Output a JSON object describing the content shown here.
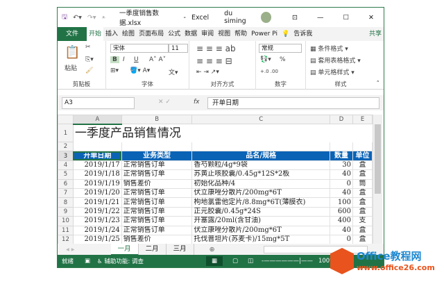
{
  "title": {
    "filename": "一季度销售数据.xlsx",
    "sep": "-",
    "app": "Excel",
    "user": "du siming"
  },
  "tabs": [
    "文件",
    "开始",
    "插入",
    "绘图",
    "页面布局",
    "公式",
    "数据",
    "审阅",
    "视图",
    "帮助",
    "Power Pi",
    "告诉我",
    "共享"
  ],
  "ribbon": {
    "paste": "粘贴",
    "clipboard": "剪贴板",
    "font_name": "宋体",
    "font_size": "11",
    "font": "字体",
    "align": "对齐方式",
    "number_format": "常规",
    "number": "数字",
    "cond_format": "条件格式",
    "table_format": "套用表格格式",
    "cell_style": "单元格样式",
    "styles": "样式",
    "percent": "%",
    "bold": "B",
    "italic": "I",
    "underline": "U"
  },
  "formula_bar": {
    "name_box": "A3",
    "fx": "fx",
    "value": "开单日期"
  },
  "columns": [
    "A",
    "B",
    "C",
    "D",
    "E"
  ],
  "title_row": "一季度产品销售情况",
  "headers": [
    "开单日期",
    "业务类型",
    "品名/规格",
    "数量",
    "单位"
  ],
  "rows": [
    [
      "2019/1/17",
      "正常销售订单",
      "香芍颗粒/4g*9袋",
      "30",
      "盒"
    ],
    [
      "2019/1/18",
      "正常销售订单",
      "苏黄止咳胶囊/0.45g*12S*2板",
      "40",
      "盒"
    ],
    [
      "2019/1/19",
      "销售差价",
      "初始化品种/4",
      "0",
      "筒"
    ],
    [
      "2019/1/20",
      "正常销售订单",
      "伏立康唑分散片/200mg*6T",
      "40",
      "盒"
    ],
    [
      "2019/1/21",
      "正常销售订单",
      "枸地氯雷他定片/8.8mg*6T(薄膜衣)",
      "100",
      "盒"
    ],
    [
      "2019/1/22",
      "正常销售订单",
      "正元胶囊/0.45g*24S",
      "600",
      "盒"
    ],
    [
      "2019/1/23",
      "正常销售订单",
      "开塞露/20ml(含甘油)",
      "400",
      "支"
    ],
    [
      "2019/1/24",
      "正常销售订单",
      "伏立康唑分散片/200mg*6T",
      "40",
      "盒"
    ],
    [
      "2019/1/25",
      "销售差价",
      "托伐普坦片(苏麦卡)/15mg*5T",
      "0",
      "盒"
    ]
  ],
  "sheets": [
    "一月",
    "二月",
    "三月"
  ],
  "status": {
    "ready": "就绪",
    "accessibility": "辅助功能: 调查",
    "zoom": "100%"
  },
  "watermark": {
    "brand": "Office教程网",
    "url": "www.office26.com"
  }
}
